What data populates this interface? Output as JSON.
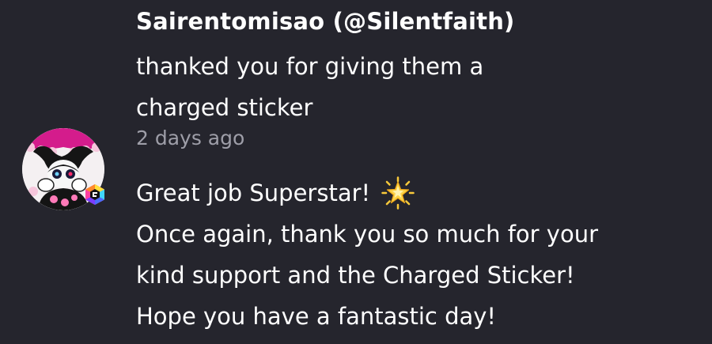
{
  "notification": {
    "user_name": "Sairentomisao (@Silentfaith)",
    "action_text": "thanked you for giving them a charged sticker",
    "timestamp": "2 days ago",
    "message_lines": [
      "Great job Superstar!",
      "Once again, thank you so much for your",
      "kind support and the Charged Sticker!",
      "Hope you have a fantastic day!"
    ],
    "emoji_icon": "glowing-star-icon"
  },
  "colors": {
    "background": "#25252d",
    "text_primary": "#ffffff",
    "text_secondary": "#9e9ea8",
    "star": "#f9c93b"
  }
}
